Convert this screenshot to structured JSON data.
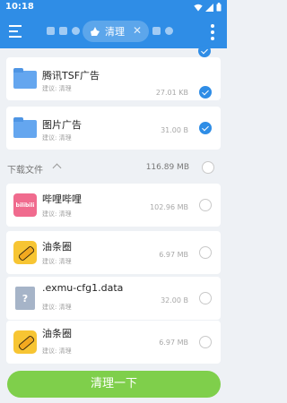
{
  "status": {
    "time": "10:18"
  },
  "header": {
    "chip_label": "清理"
  },
  "items": [
    {
      "title": "腾讯TSF广告",
      "hint": "建议: 清理",
      "size": "27.01 KB",
      "checked": true
    },
    {
      "title": "图片广告",
      "hint": "建议: 清理",
      "size": "31.00 B",
      "checked": true
    }
  ],
  "group": {
    "title": "下载文件",
    "size": "116.89 MB",
    "checked": false
  },
  "downloads": [
    {
      "title": "哔哩哔哩",
      "hint": "建议: 清理",
      "size": "102.96 MB",
      "icon": "bilibili-icon",
      "icon_text": "bilibili"
    },
    {
      "title": "油条圈",
      "hint": "建议: 清理",
      "size": "6.97 MB",
      "icon": "youtiao-icon"
    },
    {
      "title": ".exmu-cfg1.data",
      "hint": "建议: 清理",
      "size": "32.00 B",
      "icon": "unknown-file-icon",
      "icon_text": "?"
    },
    {
      "title": "油条圈",
      "hint": "建议: 清理",
      "size": "6.97 MB",
      "icon": "youtiao-icon"
    }
  ],
  "action": {
    "label": "清理一下"
  },
  "colors": {
    "primary": "#2f8de6",
    "action": "#7fcf4b"
  }
}
